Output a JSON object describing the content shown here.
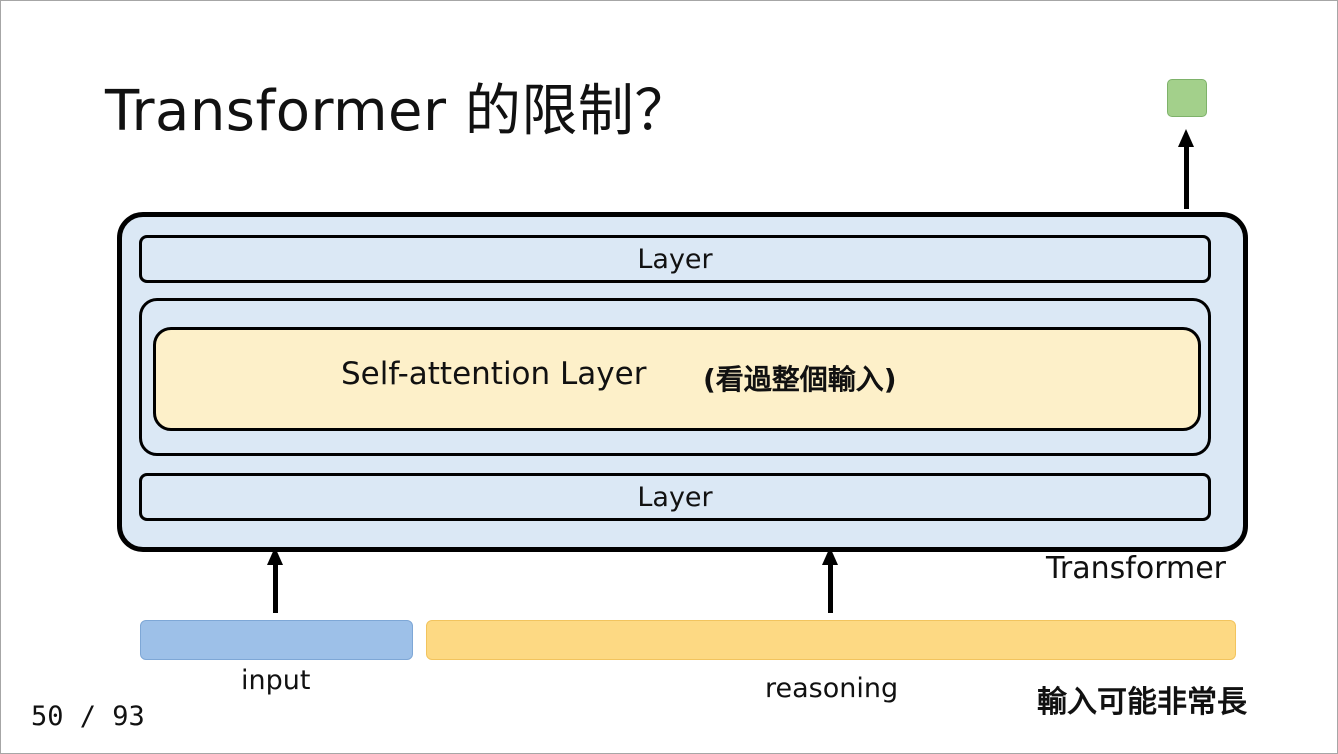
{
  "slide": {
    "title": "Transformer 的限制？",
    "page_number": "50 / 93"
  },
  "diagram": {
    "top_layer_label": "Layer",
    "self_attention_label": "Self-attention Layer",
    "self_attention_note": "(看過整個輸入)",
    "bottom_layer_label": "Layer",
    "transformer_label": "Transformer",
    "input_label": "input",
    "reasoning_label": "reasoning",
    "long_input_note": "輸入可能非常長"
  },
  "colors": {
    "layer_fill": "#dbe8f5",
    "self_attention_fill": "#fdf0c9",
    "input_bar": "#9dc0e8",
    "reasoning_bar": "#fdd983",
    "output_square": "#a3d08b"
  }
}
